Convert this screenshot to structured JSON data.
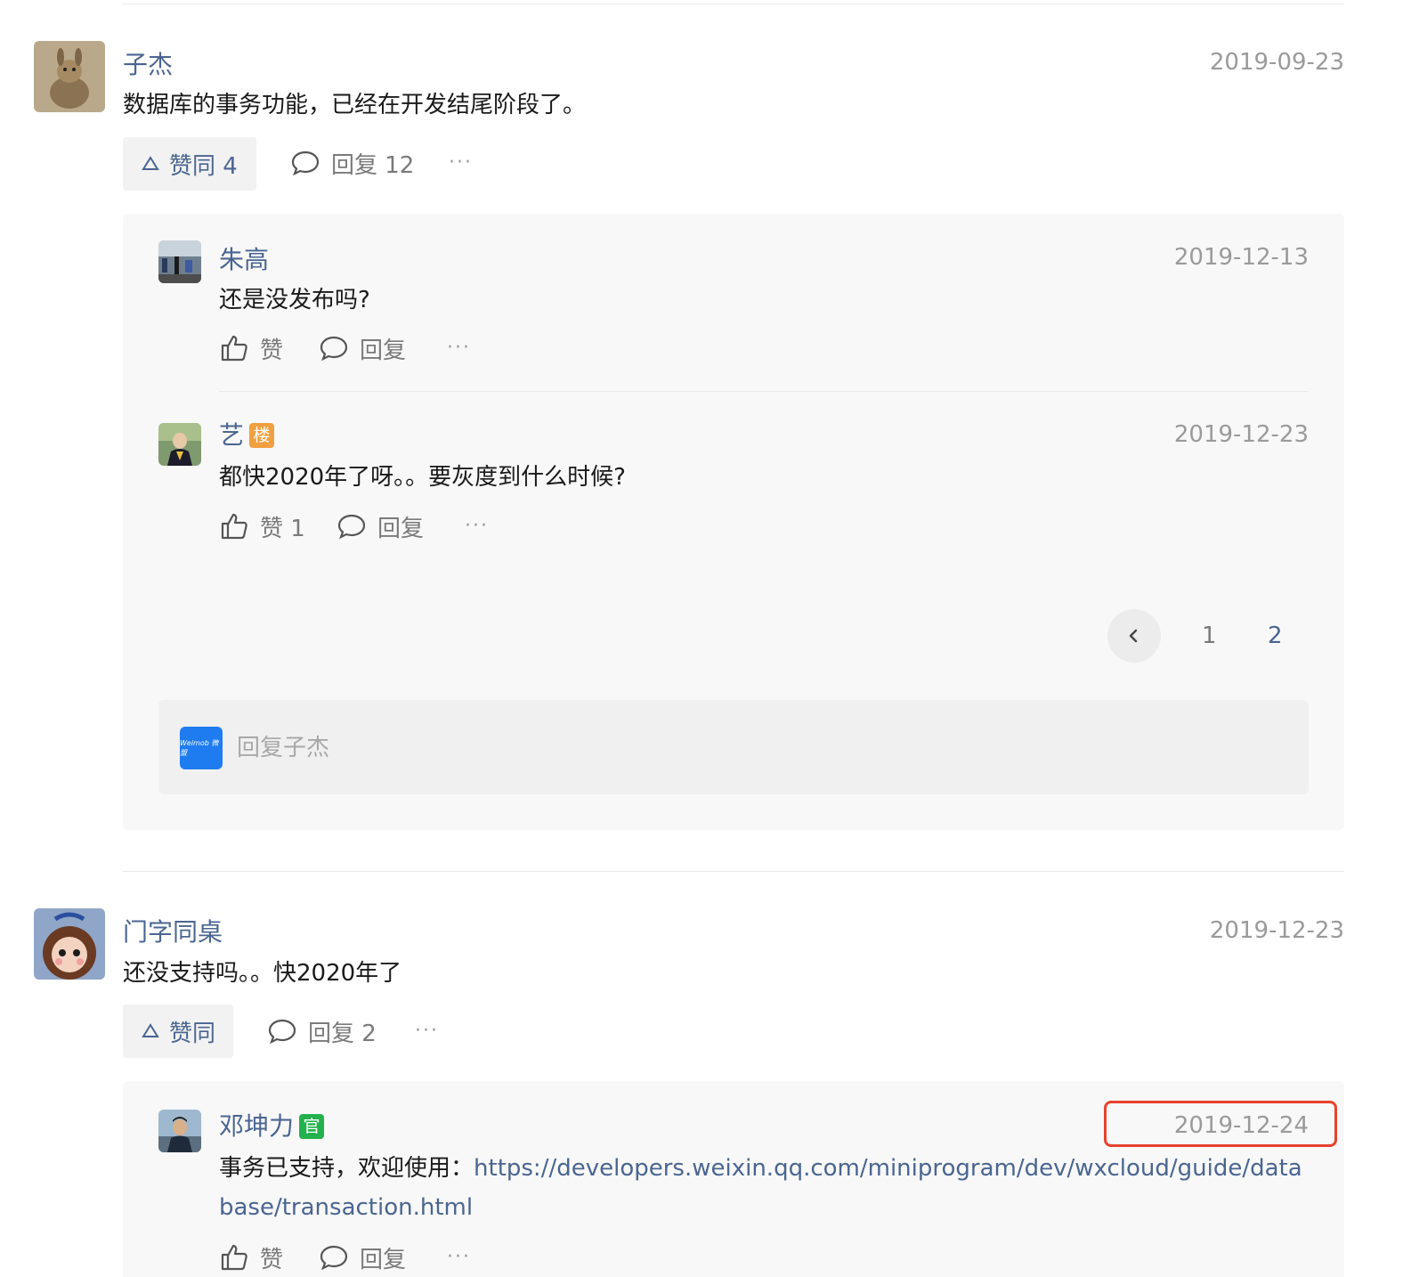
{
  "comments": [
    {
      "author": "子杰",
      "date": "2019-09-23",
      "text": "数据库的事务功能，已经在开发结尾阶段了。",
      "agree_label": "赞同 4",
      "reply_label": "回复 12",
      "more": "···",
      "replies": [
        {
          "author": "朱高",
          "date": "2019-12-13",
          "text": "还是没发布吗?",
          "like_label": "赞",
          "reply_label": "回复",
          "more": "···"
        },
        {
          "author": "艺",
          "badge": "楼",
          "date": "2019-12-23",
          "text": "都快2020年了呀。。要灰度到什么时候?",
          "like_label": "赞 1",
          "reply_label": "回复",
          "more": "···"
        }
      ],
      "pager": {
        "pages": [
          "1",
          "2"
        ],
        "active": "2"
      },
      "reply_box": {
        "avatar_text": "Weimob 微盟",
        "placeholder": "回复子杰"
      }
    },
    {
      "author": "门字同桌",
      "date": "2019-12-23",
      "text": "还没支持吗。。快2020年了",
      "agree_label": "赞同",
      "reply_label": "回复 2",
      "more": "···",
      "replies": [
        {
          "author": "邓坤力",
          "badge": "官",
          "date": "2019-12-24",
          "text_prefix": "事务已支持，欢迎使用：",
          "link_line1": "https://developers.weixin.qq.com/miniprogram/dev/wxcloud/guide/data",
          "link_line2": "base/transaction.html",
          "like_label": "赞",
          "reply_label": "回复",
          "more": "···"
        }
      ]
    }
  ],
  "colors": {
    "link": "#4a6591",
    "badge_floor": "#f0a040",
    "badge_official": "#22b14c",
    "highlight": "#e8432d"
  }
}
